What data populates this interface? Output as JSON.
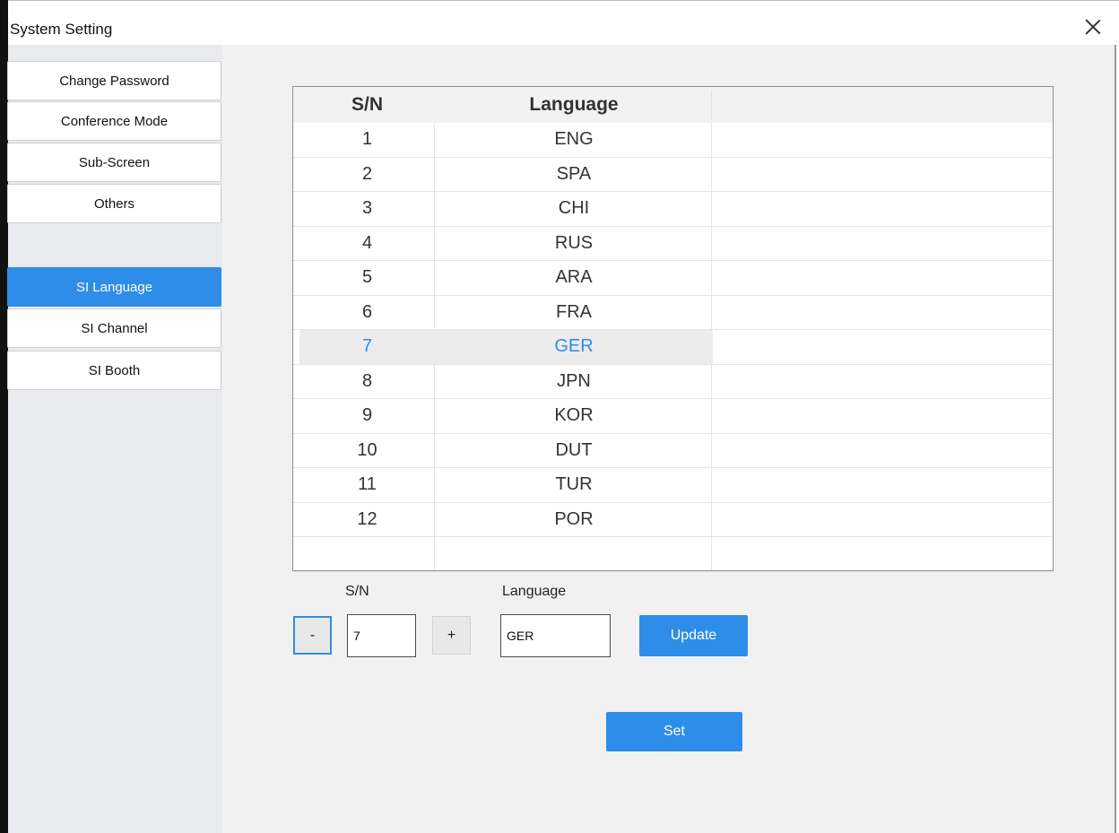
{
  "window": {
    "title": "System Setting"
  },
  "sidebar": {
    "items": [
      {
        "label": "Change Password"
      },
      {
        "label": "Conference Mode"
      },
      {
        "label": "Sub-Screen"
      },
      {
        "label": "Others"
      },
      {
        "label": "SI Language"
      },
      {
        "label": "SI Channel"
      },
      {
        "label": "SI Booth"
      }
    ],
    "active": "SI Language"
  },
  "table": {
    "headers": {
      "sn": "S/N",
      "language": "Language"
    },
    "rows": [
      {
        "sn": "1",
        "language": "ENG"
      },
      {
        "sn": "2",
        "language": "SPA"
      },
      {
        "sn": "3",
        "language": "CHI"
      },
      {
        "sn": "4",
        "language": "RUS"
      },
      {
        "sn": "5",
        "language": "ARA"
      },
      {
        "sn": "6",
        "language": "FRA"
      },
      {
        "sn": "7",
        "language": "GER"
      },
      {
        "sn": "8",
        "language": "JPN"
      },
      {
        "sn": "9",
        "language": "KOR"
      },
      {
        "sn": "10",
        "language": "DUT"
      },
      {
        "sn": "11",
        "language": "TUR"
      },
      {
        "sn": "12",
        "language": "POR"
      }
    ],
    "selected_row": "7"
  },
  "editor": {
    "sn_label": "S/N",
    "language_label": "Language",
    "minus_label": "-",
    "plus_label": "+",
    "sn_value": "7",
    "language_value": "GER",
    "update_label": "Update"
  },
  "actions": {
    "set_label": "Set"
  },
  "colors": {
    "accent": "#2e8de8",
    "sidebar_bg": "#e9eaed",
    "content_bg": "#f1f1f1"
  }
}
